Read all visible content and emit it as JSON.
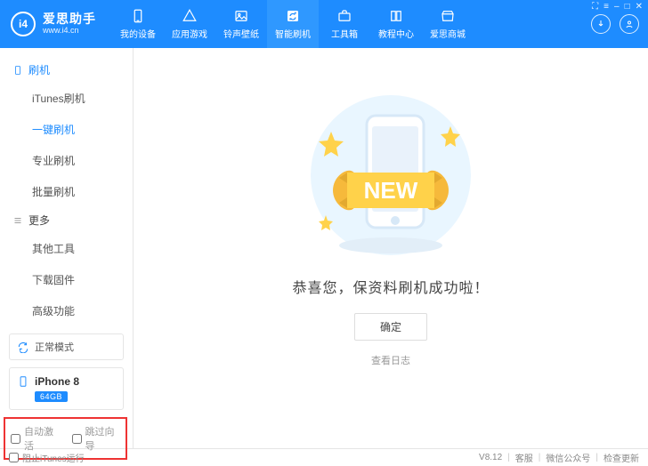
{
  "brand": {
    "logo_text": "i4",
    "cn": "爱思助手",
    "url": "www.i4.cn"
  },
  "nav": [
    {
      "label": "我的设备"
    },
    {
      "label": "应用游戏"
    },
    {
      "label": "铃声壁纸"
    },
    {
      "label": "智能刷机"
    },
    {
      "label": "工具箱"
    },
    {
      "label": "教程中心"
    },
    {
      "label": "爱思商城"
    }
  ],
  "win": {
    "cart": "⛶",
    "menu": "≡",
    "min": "–",
    "max": "□",
    "close": "✕"
  },
  "sidebar": {
    "sec1": {
      "title": "刷机",
      "items": [
        "iTunes刷机",
        "一键刷机",
        "专业刷机",
        "批量刷机"
      ],
      "activeIndex": 1
    },
    "sec2": {
      "title": "更多",
      "items": [
        "其他工具",
        "下载固件",
        "高级功能"
      ]
    },
    "mode": "正常模式",
    "device": {
      "name": "iPhone 8",
      "badge": "64GB"
    },
    "checkboxes": {
      "a": "自动激活",
      "b": "跳过向导"
    }
  },
  "main": {
    "new_text": "NEW",
    "message": "恭喜您，保资料刷机成功啦！",
    "ok": "确定",
    "log": "查看日志"
  },
  "footer": {
    "block_itunes": "阻止iTunes运行",
    "version": "V8.12",
    "links": [
      "客服",
      "微信公众号",
      "检查更新"
    ]
  }
}
